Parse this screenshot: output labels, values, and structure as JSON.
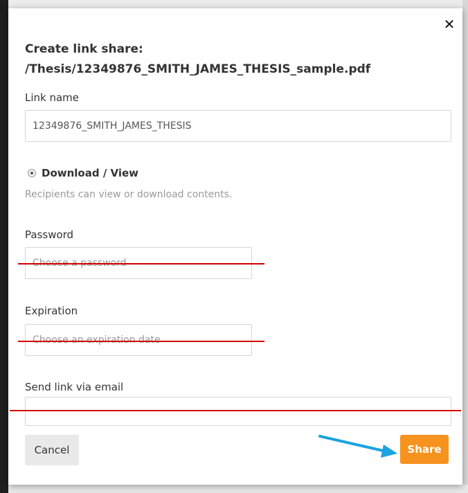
{
  "dialog": {
    "title_line1": "Create link share:",
    "title_line2": "/Thesis/12349876_SMITH_JAMES_THESIS_sample.pdf",
    "close_symbol": "✕"
  },
  "link_name": {
    "label": "Link name",
    "value": "12349876_SMITH_JAMES_THESIS"
  },
  "permission": {
    "option_label": "Download / View",
    "selected": true,
    "description": "Recipients can view or download contents."
  },
  "password": {
    "label": "Password",
    "placeholder": "Choose a password"
  },
  "expiration": {
    "label": "Expiration",
    "placeholder": "Choose an expiration date"
  },
  "email": {
    "label": "Send link via email",
    "value": ""
  },
  "actions": {
    "cancel_label": "Cancel",
    "share_label": "Share"
  },
  "colors": {
    "share_button": "#f6921e",
    "strike_line": "#d00000",
    "annotation_arrow": "#1aa3e0"
  },
  "icons": {
    "close": "close-icon",
    "radio": "radio-selected-icon",
    "arrow": "arrow-right-icon"
  }
}
